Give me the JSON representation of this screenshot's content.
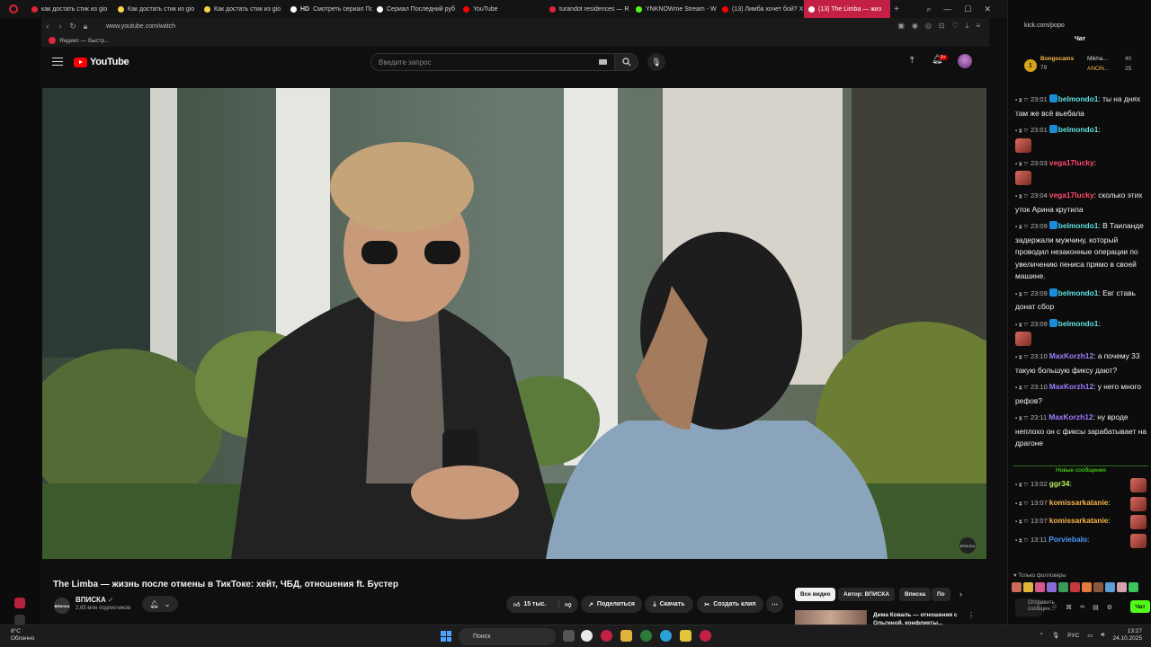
{
  "browser": {
    "tabs": [
      {
        "label": "как достать стик из gio",
        "color": "#e0243a"
      },
      {
        "label": "Как достать стик из gio",
        "color": "#f6d34a"
      },
      {
        "label": "Как достать стик из gio",
        "color": "#f6d34a"
      },
      {
        "label": "Смотреть сериал Посл",
        "color": "#ffffff",
        "prefix": "HD"
      },
      {
        "label": "Сериал Последний руб",
        "color": "#ffffff"
      },
      {
        "label": "YouTube",
        "color": "#ff0000"
      },
      {
        "label": "turandot residences — R",
        "color": "#e0243a"
      },
      {
        "label": "YNKNOWme Stream - W",
        "color": "#53fc18"
      },
      {
        "label": "(13) Лимба хочет бой? X",
        "color": "#ff0000"
      },
      {
        "label": "(13) The Limba — жиз",
        "color": "#ffffff",
        "active": true
      }
    ],
    "url": "www.youtube.com/watch",
    "bookmark": "Яндекс — быстр..."
  },
  "youtube": {
    "logo_text": "YouTube",
    "search_placeholder": "Введите запрос",
    "notif_count": "9+",
    "video_title": "The Limba — жизнь после отмены в ТикТоке: хейт, ЧБД, отношения ft. Бустер",
    "watermark": "ВПИСКА",
    "channel": {
      "name": "ВПИСКА",
      "verified": "✓",
      "subs": "2,65 млн подписчиков",
      "avatar_text": "ВПИСКА"
    },
    "actions": {
      "likes": "15 тыс.",
      "share": "Поделиться",
      "download": "Скачать",
      "clip": "Создать клип",
      "more": "⋯"
    },
    "chips": [
      "Все видео",
      "Автор: ВПИСКА",
      "Вписка",
      "По"
    ],
    "recommended": {
      "title": "Дима Коваль — отношения с Ольгиной, конфликты..."
    }
  },
  "chat": {
    "url": "kick.com/popo",
    "header": "Чат",
    "gifts": [
      {
        "name": "Bongocams",
        "amount": "79"
      },
      {
        "name": "Mikha...",
        "amount": "40"
      },
      {
        "name": "ANON...",
        "amount": "25"
      }
    ],
    "messages": [
      {
        "time": "23:01",
        "user": "belmondo1",
        "cls": "u-cyan",
        "kick": true,
        "text": "ты на днях там же всё вьебала"
      },
      {
        "time": "23:01",
        "user": "belmondo1",
        "cls": "u-cyan",
        "kick": true,
        "text": "",
        "emote": true
      },
      {
        "time": "23:03",
        "user": "vega17lucky",
        "cls": "u-red",
        "text": "",
        "emote": true
      },
      {
        "time": "23:04",
        "user": "vega17lucky",
        "cls": "u-red",
        "text": "сколько этих уток Арина крутила"
      },
      {
        "time": "23:09",
        "user": "belmondo1",
        "cls": "u-cyan",
        "kick": true,
        "text": "В Таиланде задержали мужчину, который проводил незаконные операции по увеличению пениса прямо в своей машине."
      },
      {
        "time": "23:09",
        "user": "belmondo1",
        "cls": "u-cyan",
        "kick": true,
        "text": "Евг ставь донат сбор"
      },
      {
        "time": "23:09",
        "user": "belmondo1",
        "cls": "u-cyan",
        "kick": true,
        "text": "",
        "emote": true
      },
      {
        "time": "23:10",
        "user": "MaxKorzh12",
        "cls": "u-purple",
        "text": "а почему 33 такую большую фиксу дают?"
      },
      {
        "time": "23:10",
        "user": "MaxKorzh12",
        "cls": "u-purple",
        "text": "у него много рефов?"
      },
      {
        "time": "23:11",
        "user": "MaxKorzh12",
        "cls": "u-purple",
        "text": "ну вроде неплохо он с фиксы зарабатывает на драгоне"
      }
    ],
    "new_messages_label": "Новые сообщения",
    "new_messages": [
      {
        "time": "13:02",
        "user": "ggr34",
        "cls": "u-lime",
        "text": "",
        "emote": true
      },
      {
        "time": "13:07",
        "user": "komissarkatanie",
        "cls": "u-gold",
        "text": "",
        "emote": true
      },
      {
        "time": "13:07",
        "user": "komissarkatanie",
        "cls": "u-gold",
        "text": "",
        "emote": true
      },
      {
        "time": "13:11",
        "user": "Porviebalo",
        "cls": "u-blue",
        "text": "",
        "emote": true
      }
    ],
    "followers_only": "Только фолловеры",
    "input_placeholder": "Отправить сообщен...",
    "send_label": "Чат"
  },
  "taskbar": {
    "temp": "8°C",
    "weather": "Облачно",
    "search": "Поиск",
    "lang": "РУС",
    "time": "13:27",
    "date": "24.10.2025"
  },
  "colors": {
    "accent": "#c42045",
    "kick_green": "#53fc18",
    "yt_red": "#ff0000"
  }
}
